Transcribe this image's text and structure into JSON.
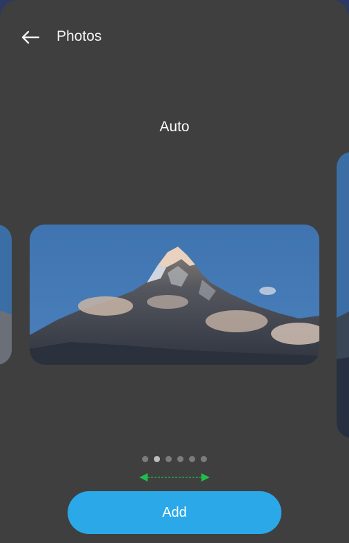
{
  "header": {
    "title": "Photos",
    "back_icon": "arrow-left-icon"
  },
  "mode": {
    "label": "Auto"
  },
  "carousel": {
    "page_count": 6,
    "active_index": 1
  },
  "swipe_hint_icon": "double-arrow-horizontal-icon",
  "actions": {
    "add_label": "Add"
  },
  "colors": {
    "background": "#3f3f3f",
    "accent": "#2aa8e8",
    "hint": "#1fbf4a"
  }
}
